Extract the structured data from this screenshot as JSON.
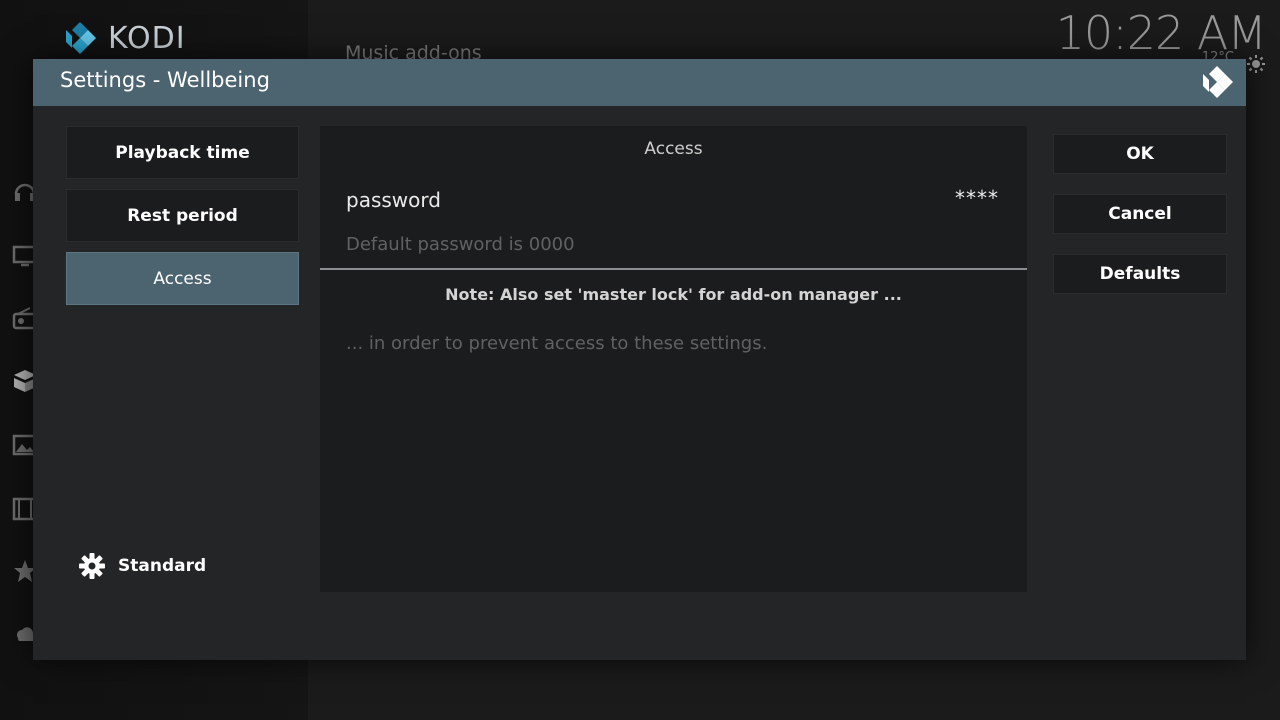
{
  "app": {
    "brand": "KODI",
    "background_heading": "Music add-ons",
    "clock": "10:22 AM",
    "weather_temp": "12°C",
    "accent_color": "#4c6370"
  },
  "sidebar_icons": [
    "headphones-icon",
    "tv-icon",
    "radio-icon",
    "addons-box-icon",
    "pictures-icon",
    "film-icon",
    "favourites-star-icon",
    "weather-icon"
  ],
  "dialog": {
    "title": "Settings - Wellbeing",
    "categories": [
      {
        "label": "Playback time",
        "active": false
      },
      {
        "label": "Rest period",
        "active": false
      },
      {
        "label": "Access",
        "active": true
      }
    ],
    "level_label": "Standard",
    "panel": {
      "heading": "Access",
      "setting": {
        "label": "password",
        "value": "****",
        "description": "Default password is 0000"
      },
      "note_title": "Note: Also set 'master lock' for add-on manager ...",
      "note_description": "... in order to prevent access to these settings."
    },
    "buttons": {
      "ok": "OK",
      "cancel": "Cancel",
      "defaults": "Defaults"
    }
  }
}
